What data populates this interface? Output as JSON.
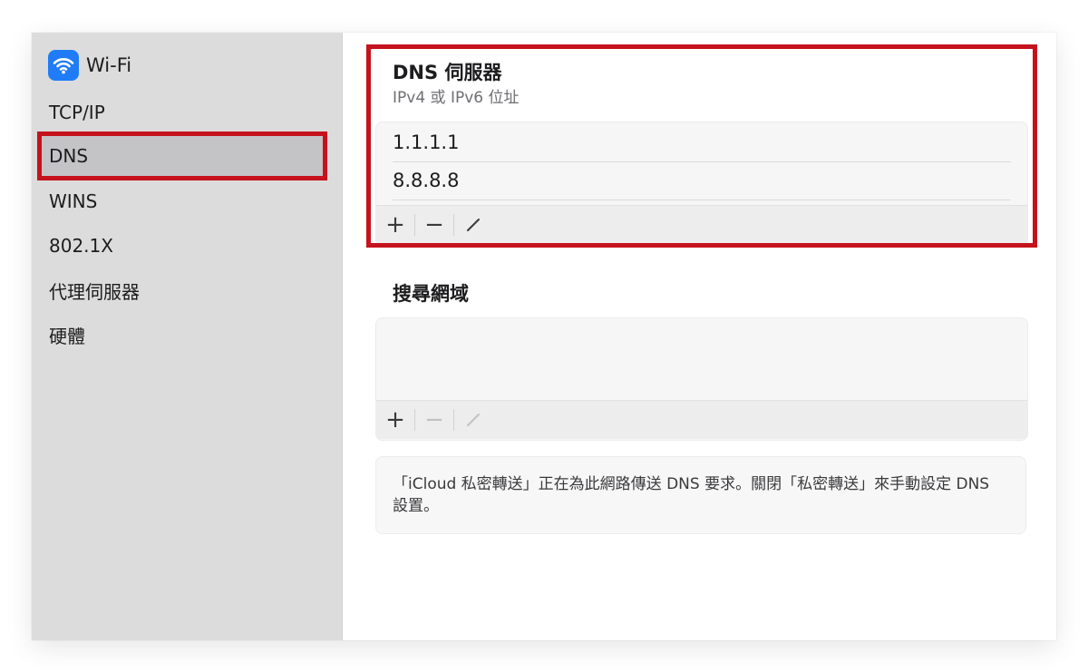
{
  "sidebar": {
    "title": "Wi-Fi",
    "items": [
      {
        "label": "TCP/IP"
      },
      {
        "label": "DNS"
      },
      {
        "label": "WINS"
      },
      {
        "label": "802.1X"
      },
      {
        "label": "代理伺服器"
      },
      {
        "label": "硬體"
      }
    ]
  },
  "dns": {
    "title": "DNS 伺服器",
    "subtitle": "IPv4 或 IPv6 位址",
    "servers": [
      "1.1.1.1",
      "8.8.8.8"
    ]
  },
  "search_domains": {
    "title": "搜尋網域"
  },
  "toolbar": {
    "add": "+",
    "remove": "−",
    "edit": "⁄"
  },
  "notice": {
    "text": "「iCloud 私密轉送」正在為此網路傳送 DNS 要求。關閉「私密轉送」來手動設定 DNS 設置。"
  },
  "colors": {
    "accent": "#1f7cf6",
    "highlight": "#c5121c",
    "sidebar_bg": "#dcdcdc"
  }
}
